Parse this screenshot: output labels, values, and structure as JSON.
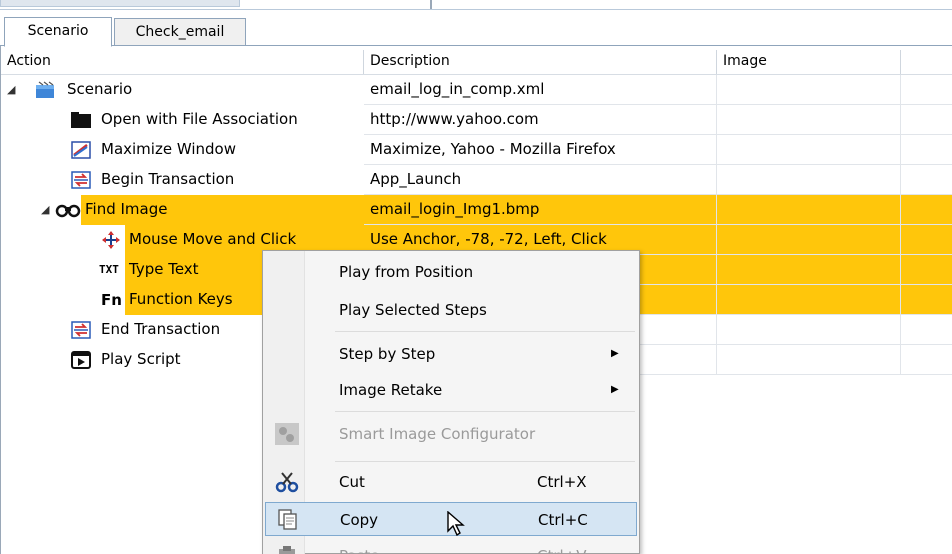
{
  "tabs": [
    {
      "label": "Scenario",
      "active": true
    },
    {
      "label": "Check_email",
      "active": false
    }
  ],
  "columns": {
    "action": "Action",
    "description": "Description",
    "image": "Image"
  },
  "rows": [
    {
      "action": "Scenario",
      "description": "email_log_in_comp.xml",
      "icon": "scenario-folder-icon",
      "selected": false
    },
    {
      "action": "Open with File Association",
      "description": "http://www.yahoo.com",
      "icon": "folder-icon",
      "selected": false
    },
    {
      "action": "Maximize Window",
      "description": "Maximize, Yahoo - Mozilla Firefox",
      "icon": "maximize-window-icon",
      "selected": false
    },
    {
      "action": "Begin Transaction",
      "description": "App_Launch",
      "icon": "transaction-icon",
      "selected": false
    },
    {
      "action": "Find Image",
      "description": "email_login_Img1.bmp",
      "icon": "binoculars-icon",
      "selected": true
    },
    {
      "action": "Mouse Move and Click",
      "description": "Use Anchor, -78, -72, Left, Click",
      "icon": "move-cross-icon",
      "selected": true
    },
    {
      "action": "Type Text",
      "description": "",
      "icon": "type-text-icon",
      "icon_text": "TXT",
      "selected": true
    },
    {
      "action": "Function Keys",
      "description": "",
      "icon": "function-keys-icon",
      "icon_text": "Fn",
      "selected": true
    },
    {
      "action": "End Transaction",
      "description": "",
      "icon": "transaction-icon",
      "selected": false
    },
    {
      "action": "Play Script",
      "description": "",
      "icon": "play-script-icon",
      "selected": false
    }
  ],
  "context_menu": {
    "items": [
      {
        "label": "Play from Position"
      },
      {
        "label": "Play Selected Steps"
      },
      {
        "label": "Step by Step",
        "submenu": true
      },
      {
        "label": "Image Retake",
        "submenu": true
      },
      {
        "label": "Smart Image Configurator",
        "disabled": true,
        "icon": "configurator-icon"
      },
      {
        "label": "Cut",
        "shortcut": "Ctrl+X",
        "icon": "scissors-icon"
      },
      {
        "label": "Copy",
        "shortcut": "Ctrl+C",
        "icon": "copy-icon",
        "hovered": true
      },
      {
        "label": "Paste",
        "shortcut": "Ctrl+V",
        "icon": "paste-icon"
      }
    ]
  },
  "colors": {
    "selection": "#ffc60b",
    "hover": "#d5e5f3"
  }
}
